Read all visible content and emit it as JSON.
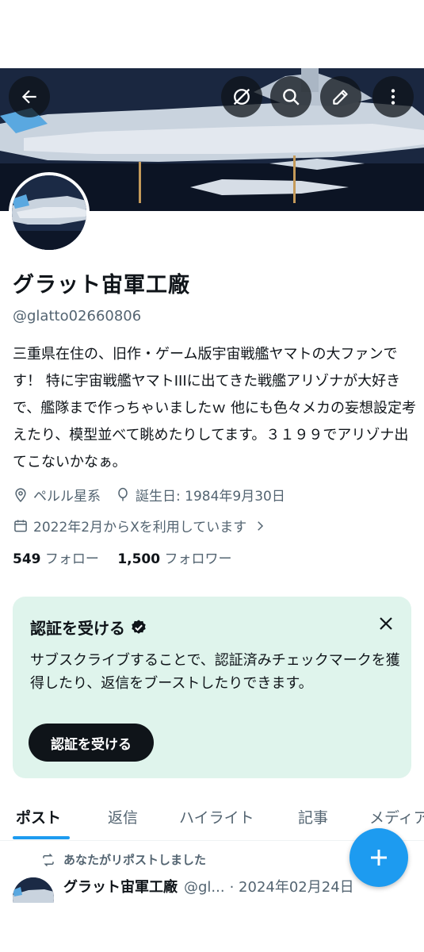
{
  "header": {
    "back_icon": "arrow-left-icon",
    "actions": [
      "repost-off-icon",
      "search-icon",
      "edit-icon",
      "more-vertical-icon"
    ]
  },
  "profile": {
    "name": "グラット宙軍工廠",
    "handle": "@glatto02660806",
    "bio": "三重県在住の、旧作・ゲーム版宇宙戦艦ヤマトの大ファンです！ 特に宇宙戦艦ヤマトIIIに出てきた戦艦アリゾナが大好きで、艦隊まで作っちゃいましたｗ 他にも色々メカの妄想設定考えたり、模型並べて眺めたりしてます。３１９９でアリゾナ出てこないかなぁ。",
    "location": "ペルル星系",
    "birthday": "誕生日: 1984年9月30日",
    "joined": "2022年2月からXを利用しています",
    "following_count": "549",
    "following_label": "フォロー",
    "followers_count": "1,500",
    "followers_label": "フォロワー"
  },
  "verify_card": {
    "title": "認証を受ける",
    "body": "サブスクライブすることで、認証済みチェックマークを獲得したり、返信をブーストしたりできます。",
    "button_label": "認証を受ける"
  },
  "tabs": [
    {
      "label": "ポスト",
      "active": true
    },
    {
      "label": "返信",
      "active": false
    },
    {
      "label": "ハイライト",
      "active": false
    },
    {
      "label": "記事",
      "active": false
    },
    {
      "label": "メディア",
      "active": false
    }
  ],
  "post": {
    "repost_label": "あなたがリポストしました",
    "author_name": "グラット宙軍工廠",
    "author_handle": "@gl...",
    "date": "· 2024年02月24日"
  },
  "colors": {
    "accent": "#1d9bf0",
    "verify_bg": "#dff4ec",
    "text_primary": "#0f1419",
    "text_secondary": "#536471"
  }
}
